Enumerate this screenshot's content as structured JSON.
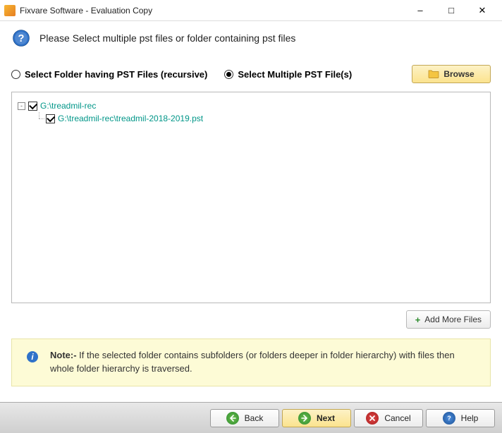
{
  "titlebar": {
    "title": "Fixvare Software - Evaluation Copy"
  },
  "header": {
    "text": "Please Select multiple pst files or folder containing pst files"
  },
  "options": {
    "radio_folder": {
      "label": "Select Folder having PST Files (recursive)",
      "selected": false
    },
    "radio_multiple": {
      "label": "Select Multiple PST File(s)",
      "selected": true
    },
    "browse_label": "Browse"
  },
  "tree": {
    "root": {
      "label": "G:\\treadmil-rec",
      "checked": true,
      "expanded": true
    },
    "child": {
      "label": "G:\\treadmil-rec\\treadmil-2018-2019.pst",
      "checked": true
    }
  },
  "add_more_label": "Add More Files",
  "note": {
    "prefix": "Note:- ",
    "text": "If the selected folder contains subfolders (or folders deeper in folder hierarchy) with files then whole folder hierarchy is traversed."
  },
  "footer": {
    "back": "Back",
    "next": "Next",
    "cancel": "Cancel",
    "help": "Help"
  }
}
